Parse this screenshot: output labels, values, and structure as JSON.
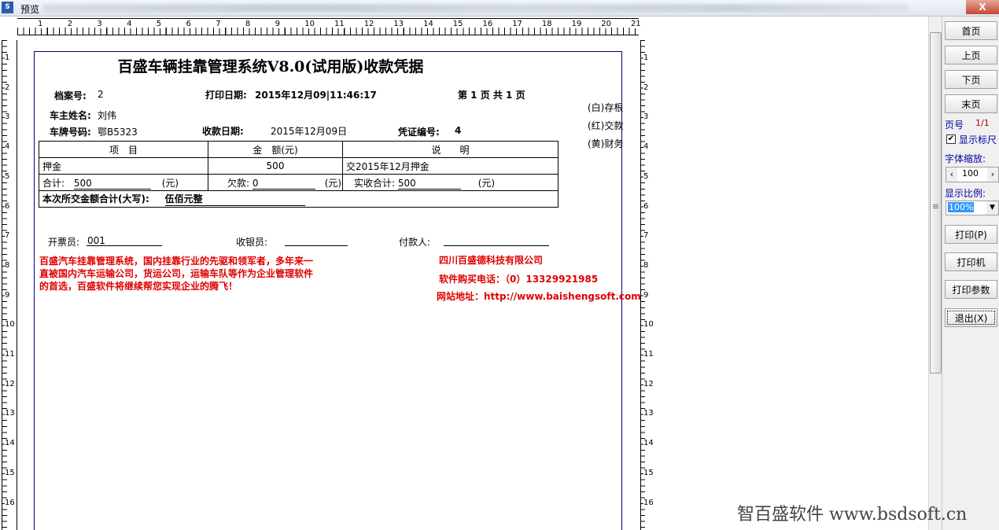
{
  "window": {
    "title": "预览",
    "close": "X"
  },
  "ruler": {
    "top_numbers": [
      "1",
      "2",
      "3",
      "4",
      "5",
      "6",
      "7",
      "8",
      "9",
      "10",
      "11",
      "12",
      "13",
      "14",
      "15",
      "16",
      "17",
      "18",
      "19",
      "20",
      "21"
    ],
    "left_numbers": [
      "1",
      "2",
      "3",
      "4",
      "5",
      "6",
      "7",
      "8",
      "9",
      "10",
      "11",
      "12",
      "13",
      "14",
      "15",
      "16"
    ]
  },
  "receipt": {
    "title": "百盛车辆挂靠管理系统V8.0(试用版)收款凭据",
    "file_no_label": "档案号:",
    "file_no": "2",
    "print_date_label": "打印日期:",
    "print_date": "2015年12月09|11:46:17",
    "page_info": "第 1 页 共 1 页",
    "owner_label": "车主姓名:",
    "owner": "刘伟",
    "plate_label": "车牌号码:",
    "plate": "鄂B5323",
    "receive_date_label": "收款日期:",
    "receive_date": "2015年12月09日",
    "voucher_label": "凭证编号:",
    "voucher": "4",
    "copies": [
      "(白)存根",
      "(红)交款",
      "(黄)财务"
    ],
    "table": {
      "headers": [
        "项　目",
        "金　额(元)",
        "说　　明"
      ],
      "item": "押金",
      "amount": "500",
      "note": "交2015年12月押金",
      "total_label": "合计:",
      "total": "500",
      "debt_label": "欠款:",
      "debt": "0",
      "paid_label": "实收合计:",
      "paid": "500",
      "unit": "(元)",
      "words_label": "本次所交金额合计(大写):",
      "words": "伍佰元整"
    },
    "issuer_label": "开票员:",
    "issuer": "001",
    "cashier_label": "收银员:",
    "payer_label": "付款人:",
    "promo": [
      "百盛汽车挂靠管理系统，国内挂靠行业的先驱和领军者，多年来一",
      "直被国内汽车运输公司，货运公司，运输车队等作为企业管理软件",
      "的首选，百盛软件将继续帮您实现企业的腾飞！"
    ],
    "company": "四川百盛德科技有限公司",
    "phone": "软件购买电话：（0）13329921985",
    "website": "网站地址：http://www.baishengsoft.com"
  },
  "panel": {
    "first": "首页",
    "prev": "上页",
    "next": "下页",
    "last": "末页",
    "page_label": "页号",
    "page_value": "1/1",
    "show_ruler": "显示标尺",
    "show_ruler_checked": "✔",
    "font_zoom_label": "字体缩放:",
    "font_zoom": "100",
    "scale_label": "显示比例:",
    "scale": "100%",
    "print": "打印(P)",
    "printer": "打印机",
    "print_params": "打印参数",
    "exit": "退出(X)"
  },
  "watermark": "智百盛软件 www.bsdsoft.cn"
}
